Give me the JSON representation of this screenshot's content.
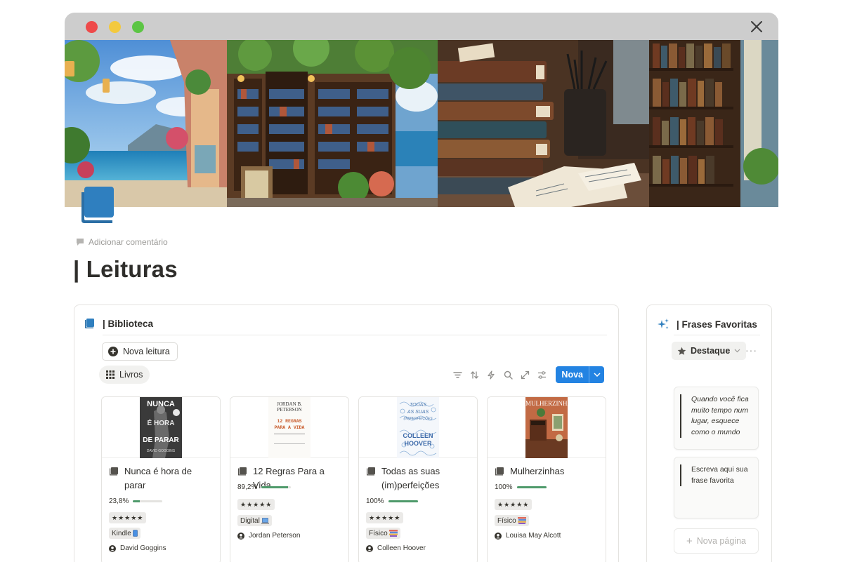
{
  "window": {
    "controls": [
      "close",
      "minimize",
      "maximize"
    ],
    "close_icon": "close-icon"
  },
  "page": {
    "icon": "book-icon",
    "add_comment": "Adicionar comentário",
    "title": "| Leituras"
  },
  "library": {
    "title": "| Biblioteca",
    "new_reading": "Nova leitura",
    "view_tab": "Livros",
    "new_button": "Nova",
    "toolbar_icons": [
      "filter-icon",
      "sort-icon",
      "automation-icon",
      "search-icon",
      "expand-icon",
      "settings-icon"
    ],
    "books": [
      {
        "cover_text": [
          "NUNCA",
          "É HORA",
          "DE PARAR",
          "DAVID GOGGINS"
        ],
        "title": "Nunca é hora de parar",
        "progress_label": "23,8%",
        "progress": 0.238,
        "rating": "★★★★★",
        "format": "Kindle",
        "format_icon": "phone-icon",
        "author": "David Goggins"
      },
      {
        "cover_text": [
          "JORDAN B.",
          "PETERSON",
          "12 REGRAS",
          "PARA A VIDA"
        ],
        "title": "12 Regras Para a Vida",
        "progress_label": "89,2%",
        "progress": 0.892,
        "rating": "★★★★★",
        "format": "Digital",
        "format_icon": "laptop-icon",
        "author": "Jordan Peterson"
      },
      {
        "cover_text": [
          "TODAS",
          "AS SUAS",
          "(IM)PERFEIÇÕES",
          "COLLEEN",
          "HOOVER"
        ],
        "title": "Todas as suas (im)perfeições",
        "progress_label": "100%",
        "progress": 1.0,
        "rating": "★★★★★",
        "format": "Físico",
        "format_icon": "books-icon",
        "author": "Colleen Hoover"
      },
      {
        "cover_text": [
          "MULHERZINHAS"
        ],
        "title": "Mulherzinhas",
        "progress_label": "100%",
        "progress": 1.0,
        "rating": "★★★★★",
        "format": "Físico",
        "format_icon": "books-icon",
        "author": "Louisa May Alcott"
      }
    ]
  },
  "favorites": {
    "title": "| Frases Favoritas",
    "view_select": "Destaque",
    "quotes": [
      {
        "text": "Quando você fica muito tempo num lugar, esquece como o mundo"
      },
      {
        "text": "Escreva aqui sua frase favorita"
      }
    ],
    "new_page": "Nova página"
  },
  "colors": {
    "accent": "#2383e2",
    "progress": "#4f9a6b",
    "icon_blue": "#2f7fbf"
  }
}
